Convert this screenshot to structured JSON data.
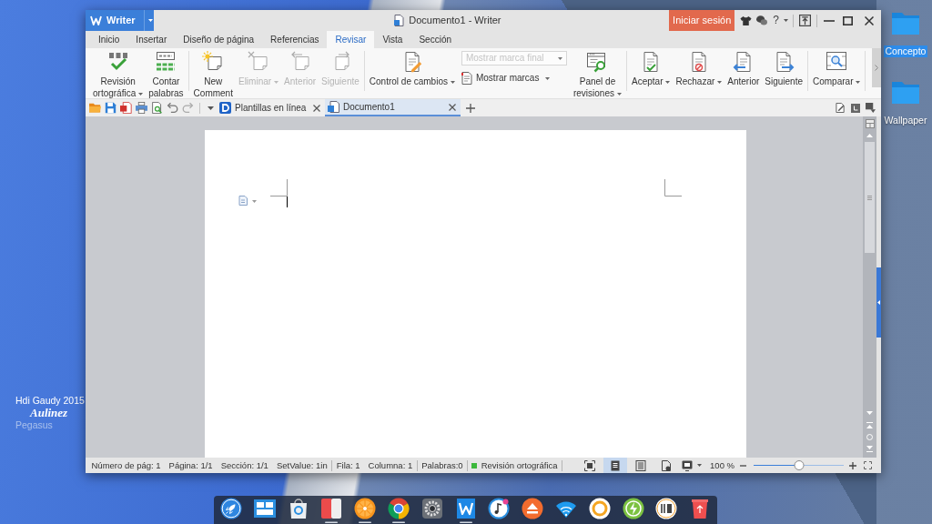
{
  "desktop": {
    "icons": [
      {
        "label": "Concepto",
        "selected": true
      },
      {
        "label": "Wallpaper",
        "selected": false
      }
    ],
    "signature": [
      "Hdi Gaudy 2015",
      "Aulinez",
      "Pegasus"
    ]
  },
  "window": {
    "app_button": "Writer",
    "title": "Documento1 - Writer",
    "login_button": "Iniciar sesión",
    "help_button": "?"
  },
  "menu_tabs": [
    {
      "label": "Inicio",
      "selected": false
    },
    {
      "label": "Insertar",
      "selected": false
    },
    {
      "label": "Diseño de página",
      "selected": false
    },
    {
      "label": "Referencias",
      "selected": false
    },
    {
      "label": "Revisar",
      "selected": true
    },
    {
      "label": "Vista",
      "selected": false
    },
    {
      "label": "Sección",
      "selected": false
    }
  ],
  "ribbon": {
    "groups": [
      [
        {
          "kind": "large",
          "label": [
            "Revisión",
            "ortográfica"
          ],
          "dropdown": true,
          "disabled": false
        },
        {
          "kind": "large",
          "label": [
            "Contar",
            "palabras"
          ],
          "dropdown": false,
          "disabled": false
        }
      ],
      [
        {
          "kind": "large",
          "label": [
            "New",
            "Comment"
          ],
          "dropdown": false,
          "disabled": false
        },
        {
          "kind": "large",
          "label": [
            "Eliminar"
          ],
          "dropdown": true,
          "disabled": true
        },
        {
          "kind": "large",
          "label": [
            "Anterior"
          ],
          "dropdown": false,
          "disabled": true
        },
        {
          "kind": "large",
          "label": [
            "Siguiente"
          ],
          "dropdown": false,
          "disabled": true
        }
      ],
      [
        {
          "kind": "large",
          "label": [
            "Control de cambios"
          ],
          "dropdown": true,
          "disabled": false
        },
        {
          "kind": "stack",
          "select": {
            "value": "Mostrar marca final",
            "disabled": true
          },
          "button": {
            "label": "Mostrar marcas",
            "dropdown": true
          }
        },
        {
          "kind": "large",
          "label": [
            "Panel de",
            "revisiones"
          ],
          "dropdown": true,
          "disabled": false
        }
      ],
      [
        {
          "kind": "large",
          "label": [
            "Aceptar"
          ],
          "dropdown": true,
          "disabled": false
        },
        {
          "kind": "large",
          "label": [
            "Rechazar"
          ],
          "dropdown": true,
          "disabled": false
        },
        {
          "kind": "large",
          "label": [
            "Anterior"
          ],
          "dropdown": false,
          "disabled": false
        },
        {
          "kind": "large",
          "label": [
            "Siguiente"
          ],
          "dropdown": false,
          "disabled": false
        }
      ],
      [
        {
          "kind": "large",
          "label": [
            "Comparar"
          ],
          "dropdown": true,
          "disabled": false
        }
      ]
    ]
  },
  "doc_tabs": [
    {
      "label": "Plantillas en línea",
      "selected": false
    },
    {
      "label": "Documento1",
      "selected": true
    }
  ],
  "status_bar": {
    "items": [
      {
        "kind": "text",
        "text": "Número de pág: 1"
      },
      {
        "kind": "text",
        "text": "Página: 1/1"
      },
      {
        "kind": "text",
        "text": "Sección: 1/1"
      },
      {
        "kind": "text",
        "text": "SetValue: 1in"
      },
      {
        "kind": "text",
        "text": "Fila: 1"
      },
      {
        "kind": "text",
        "text": "Columna: 1"
      },
      {
        "kind": "text",
        "text": "Palabras:0"
      },
      {
        "kind": "check",
        "text": "Revisión ortográfica"
      }
    ],
    "views": [
      {
        "selected": false
      },
      {
        "selected": true
      },
      {
        "selected": false
      },
      {
        "selected": false
      },
      {
        "selected": false
      }
    ],
    "zoom": {
      "text": "100 %",
      "level": 0.5
    }
  },
  "dock": [
    {
      "running": false
    },
    {
      "running": false
    },
    {
      "running": false
    },
    {
      "running": true
    },
    {
      "running": true
    },
    {
      "running": true
    },
    {
      "running": false
    },
    {
      "running": true
    },
    {
      "running": false
    },
    {
      "running": false
    },
    {
      "running": false
    },
    {
      "running": false
    },
    {
      "running": false
    },
    {
      "running": false
    },
    {
      "running": false
    }
  ]
}
